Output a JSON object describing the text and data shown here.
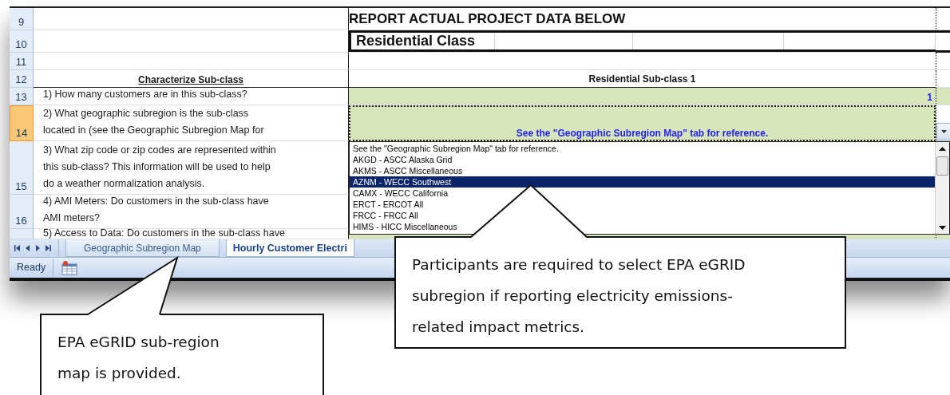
{
  "rows": [
    {
      "number": "9",
      "kind": "title",
      "value": "REPORT ACTUAL PROJECT DATA BELOW",
      "selected": false
    },
    {
      "number": "10",
      "kind": "class",
      "value": "Residential Class",
      "selected": false
    },
    {
      "number": "11",
      "kind": "blank",
      "selected": false
    },
    {
      "number": "12",
      "kind": "header",
      "question": [
        "Characterize Sub-class"
      ],
      "value": "Residential Sub-class 1",
      "selected": false
    },
    {
      "number": "13",
      "kind": "question",
      "question": [
        "1) How many customers are in this sub-class?"
      ],
      "value": "1",
      "selected": false
    },
    {
      "number": "14",
      "kind": "dropdown",
      "question": [
        "2) What geographic subregion is the sub-class",
        "located in (see the Geographic Subregion Map for"
      ],
      "value": "See the \"Geographic Subregion Map\" tab for reference.",
      "selected": true
    },
    {
      "number": "15",
      "kind": "question",
      "question": [
        "3) What zip code or zip codes are represented within",
        "this sub-class? This information will be used to help",
        "do a weather normalization analysis."
      ],
      "selected": false
    },
    {
      "number": "16",
      "kind": "question",
      "question": [
        "4) AMI Meters: Do customers in the sub-class have",
        "AMI meters?"
      ],
      "selected": false
    },
    {
      "number": "",
      "kind": "partial",
      "question": [
        "5) Access to Data: Do customers in the sub-class have"
      ],
      "selected": false
    }
  ],
  "dropdown_list": [
    {
      "label": "See the \"Geographic Subregion Map\" tab for reference.",
      "selected": false
    },
    {
      "label": "AKGD - ASCC Alaska Grid",
      "selected": false
    },
    {
      "label": "AKMS - ASCC Miscellaneous",
      "selected": false
    },
    {
      "label": "AZNM - WECC Southwest",
      "selected": true
    },
    {
      "label": "CAMX - WECC California",
      "selected": false
    },
    {
      "label": "ERCT - ERCOT All",
      "selected": false
    },
    {
      "label": "FRCC - FRCC All",
      "selected": false
    },
    {
      "label": "HIMS - HICC Miscellaneous",
      "selected": false
    }
  ],
  "sheet_tabs": [
    {
      "label": "Geographic Subregion Map",
      "selected": false
    },
    {
      "label": "Hourly Customer Electri",
      "selected": true
    }
  ],
  "status_bar": {
    "text": "Ready"
  },
  "callouts": [
    {
      "text": "EPA eGRID sub-region\nmap is provided."
    },
    {
      "text": "Participants are required to select EPA eGRID\nsubregion if reporting electricity emissions-\nrelated impact metrics."
    }
  ]
}
